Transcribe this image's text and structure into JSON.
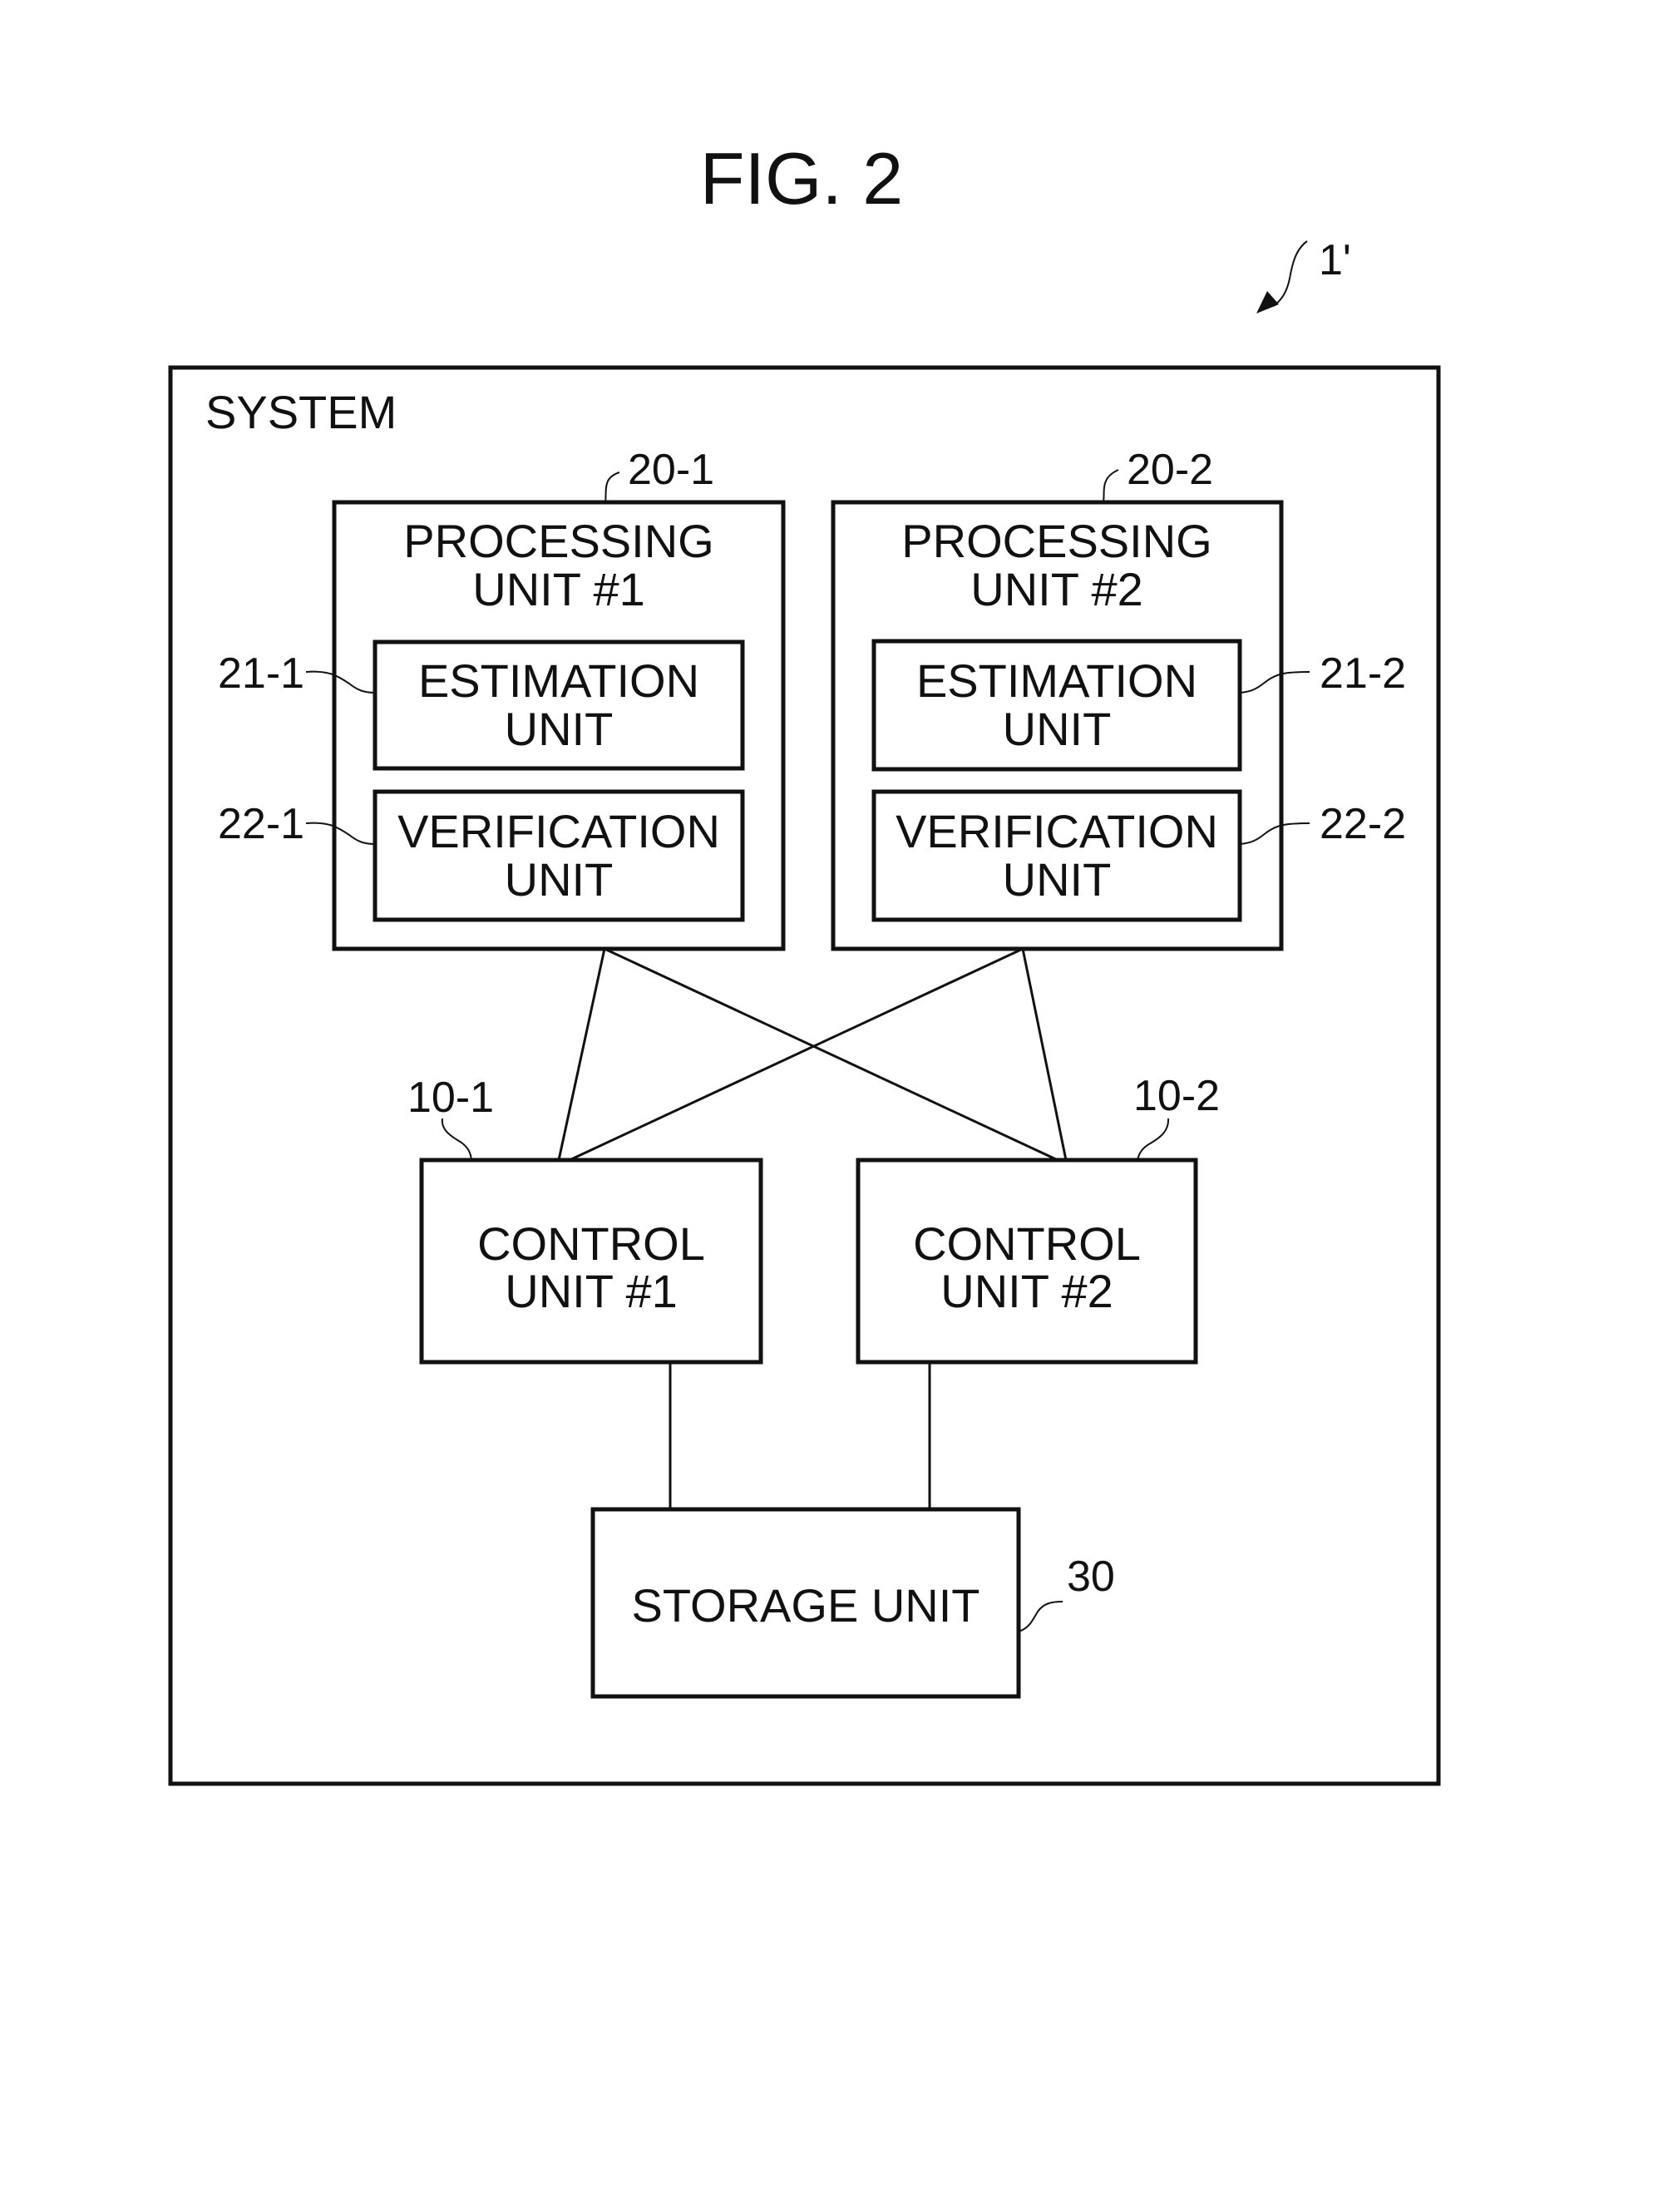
{
  "figure": {
    "title": "FIG. 2",
    "system_ref": "1'"
  },
  "system": {
    "label": "SYSTEM"
  },
  "processing_units": [
    {
      "ref": "20-1",
      "title_line1": "PROCESSING",
      "title_line2": "UNIT #1",
      "estimation": {
        "ref": "21-1",
        "line1": "ESTIMATION",
        "line2": "UNIT"
      },
      "verification": {
        "ref": "22-1",
        "line1": "VERIFICATION",
        "line2": "UNIT"
      }
    },
    {
      "ref": "20-2",
      "title_line1": "PROCESSING",
      "title_line2": "UNIT #2",
      "estimation": {
        "ref": "21-2",
        "line1": "ESTIMATION",
        "line2": "UNIT"
      },
      "verification": {
        "ref": "22-2",
        "line1": "VERIFICATION",
        "line2": "UNIT"
      }
    }
  ],
  "control_units": [
    {
      "ref": "10-1",
      "line1": "CONTROL",
      "line2": "UNIT #1"
    },
    {
      "ref": "10-2",
      "line1": "CONTROL",
      "line2": "UNIT #2"
    }
  ],
  "storage_unit": {
    "ref": "30",
    "label": "STORAGE UNIT"
  },
  "connections": [
    {
      "from": "20-1",
      "to": "10-1"
    },
    {
      "from": "20-1",
      "to": "10-2"
    },
    {
      "from": "20-2",
      "to": "10-1"
    },
    {
      "from": "20-2",
      "to": "10-2"
    },
    {
      "from": "10-1",
      "to": "30"
    },
    {
      "from": "10-2",
      "to": "30"
    }
  ]
}
